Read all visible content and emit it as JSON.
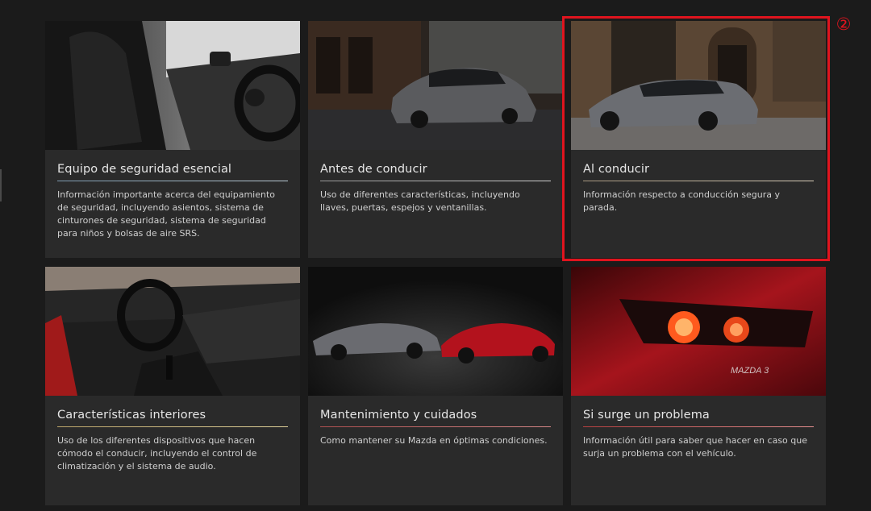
{
  "colors": {
    "highlight": "#e0141e",
    "card_background": "#2a2a2a",
    "page_background": "#1b1b1b"
  },
  "annotation": {
    "marker": "②"
  },
  "cards": [
    {
      "title": "Equipo de seguridad esencial",
      "description": "Información importante acerca del equipamiento de seguridad, incluyendo asientos, sistema de cinturones de seguridad, sistema de seguridad para niños y bolsas de aire SRS.",
      "image": "car-interior-front-seats-steering-wheel"
    },
    {
      "title": "Antes de conducir",
      "description": "Uso de diferentes características, incluyendo llaves, puertas, espejos y ventanillas.",
      "image": "gray-sedan-city-street-night"
    },
    {
      "title": "Al conducir",
      "description": "Información respecto a conducción segura y parada.",
      "image": "gray-sedan-parked-stone-building"
    },
    {
      "title": "Características interiores",
      "description": "Uso de los diferentes dispositivos que hacen cómodo el conducir, incluyendo el control de climatización y el sistema de audio.",
      "image": "car-interior-dashboard-gear-shift"
    },
    {
      "title": "Mantenimiento y cuidados",
      "description": "Como mantener su Mazda en óptimas condiciones.",
      "image": "gray-sedan-red-hatchback-dark-studio"
    },
    {
      "title": "Si surge un problema",
      "description": "Información útil para saber que hacer en caso que surja un problema con el vehículo.",
      "image": "red-hatchback-tail-lights-closeup",
      "badge": "MAZDA 3"
    }
  ]
}
